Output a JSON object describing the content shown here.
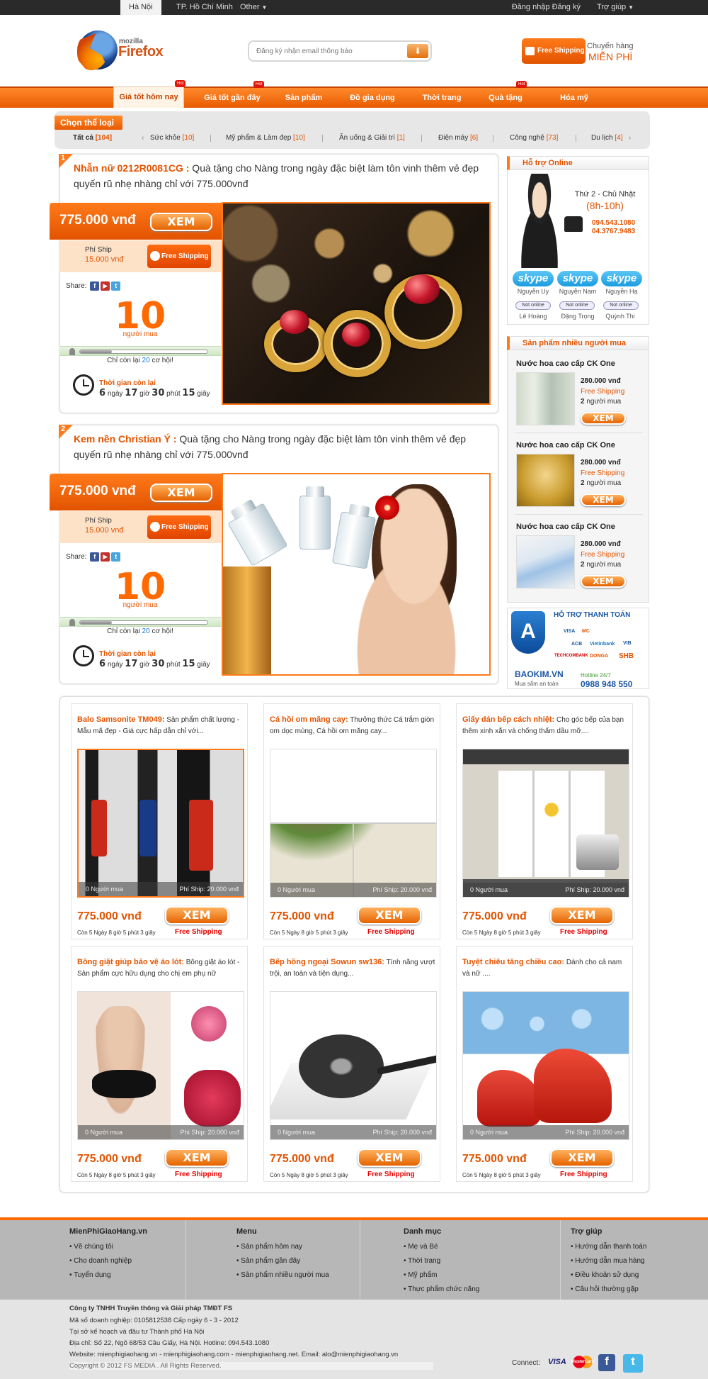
{
  "topbar": {
    "cities": [
      "Hà Nội",
      "TP. Hồ Chí Minh",
      "Other"
    ],
    "login": "Đăng nhập",
    "register": "Đăng ký",
    "help": "Trợ giúp"
  },
  "header": {
    "logo_small": "mozilla",
    "logo_text": "Firefox",
    "subscribe_placeholder": "Đăng ký nhận email thông báo",
    "free_shipping": "Free Shipping",
    "transport_line1": "Chuyển hàng",
    "transport_line2": "MIỄN PHÍ"
  },
  "nav": {
    "items": [
      "Giá tốt hôm nay",
      "Giá tốt gần đây",
      "Sản phẩm",
      "Đồ gia dụng",
      "Thời trang",
      "Quà tặng",
      "Hóa mỹ phẩm"
    ],
    "hot_label": "Hot"
  },
  "categories": {
    "title": "Chọn thể loại",
    "all_label": "Tất cả",
    "all_count": "[104]",
    "items": [
      {
        "label": "Sức khỏe",
        "count": "[10]"
      },
      {
        "label": "Mỹ phẩm & Làm đẹp",
        "count": "[10]"
      },
      {
        "label": "Ăn uống & Giải trí",
        "count": "[1]"
      },
      {
        "label": "Điện máy",
        "count": "[6]"
      },
      {
        "label": "Công nghệ",
        "count": "[73]"
      },
      {
        "label": "Du lịch",
        "count": "[4]"
      }
    ],
    "prev": "‹",
    "next": "›"
  },
  "deals": [
    {
      "num": "1",
      "name": "Nhẫn nữ 0212R0081CG :",
      "desc": " Quà tặng cho Nàng trong ngày đặc biệt làm tôn vinh thêm vẻ đẹp quyến rũ nhẹ nhàng chỉ với 775.000vnđ",
      "price": "775.000 vnđ",
      "xem": "XEM",
      "ship_label": "Phí Ship",
      "ship_price": "15.000 vnđ",
      "free_shipping": "Free Shipping",
      "share": "Share:",
      "buyers": "10",
      "buyers_label": "người mua",
      "remaining_prefix": "Chỉ còn lại ",
      "remaining_n": "20",
      "remaining_suffix": " cơ hội!",
      "progress": 0.25,
      "time_label": "Thời gian còn lại",
      "days": "6",
      "hours": "17",
      "mins": "30",
      "secs": "15",
      "u_day": " ngày ",
      "u_hour": " giờ ",
      "u_min": " phút ",
      "u_sec": " giây"
    },
    {
      "num": "2",
      "name": "Kem nền Christian Ý :",
      "desc": " Quà tặng cho Nàng trong ngày đặc biệt làm tôn vinh thêm vẻ đẹp quyến rũ nhẹ nhàng chỉ với 775.000vnđ",
      "price": "775.000 vnđ",
      "xem": "XEM",
      "ship_label": "Phí Ship",
      "ship_price": "15.000 vnđ",
      "free_shipping": "Free Shipping",
      "share": "Share:",
      "buyers": "10",
      "buyers_label": "người mua",
      "remaining_prefix": "Chỉ còn lại ",
      "remaining_n": "20",
      "remaining_suffix": " cơ hội!",
      "progress": 0.25,
      "time_label": "Thời gian còn lại",
      "days": "6",
      "hours": "17",
      "mins": "30",
      "secs": "15",
      "u_day": " ngày ",
      "u_hour": " giờ ",
      "u_min": " phút ",
      "u_sec": " giây"
    }
  ],
  "support": {
    "title": "Hỗ trợ Online",
    "days": "Thứ 2 - Chủ Nhật",
    "hours": "(8h-10h)",
    "phone1": "094.543.1080",
    "phone2": "04.3767.9483",
    "skype_label": "skype",
    "skype_names": [
      "Nguyễn Uy",
      "Nguyễn Nam",
      "Nguyễn Hạ"
    ],
    "status": "Not online",
    "status_names": [
      "Lê Hoàng",
      "Đặng Trọng",
      "Quỳnh Thi"
    ]
  },
  "bestsellers": {
    "title": "Sản phẩm nhiều người mua",
    "items": [
      {
        "name": "Nước hoa cao cấp CK One",
        "price": "280.000 vnđ",
        "free": "Free Shipping",
        "buyers": "2",
        "buyers_label": " người mua",
        "xem": "XEM"
      },
      {
        "name": "Nước hoa cao cấp CK One",
        "price": "280.000 vnđ",
        "free": "Free Shipping",
        "buyers": "2",
        "buyers_label": " người mua",
        "xem": "XEM"
      },
      {
        "name": "Nước hoa cao cấp CK One",
        "price": "280.000 vnđ",
        "free": "Free Shipping",
        "buyers": "2",
        "buyers_label": " người mua",
        "xem": "XEM"
      }
    ]
  },
  "payment": {
    "title": "HỖ TRỢ THANH TOÁN",
    "banks": [
      "VISA",
      "MC",
      "ACB",
      "Vietinbank",
      "VIB",
      "TECHCOMBANK",
      "DONGA",
      "SHB"
    ],
    "brand": "BAOKIM.VN",
    "brand_sub": "Mua sắm an toàn",
    "hotline_label": "Hotline 24/7",
    "hotline": "0988 948 550"
  },
  "products": [
    {
      "title": "Balo Samsonite TM049:",
      "desc": " Sản phẩm chất lượng - Mẫu mã đẹp - Giá cực hấp dẫn chỉ với...",
      "buyers": "0 Người mua",
      "ship": "Phí Ship: 20.000 vnđ",
      "price": "775.000 vnđ",
      "xem": "XEM",
      "remain": "Còn 5 Ngày 8 giờ 5 phút 3 giây",
      "free": "Free Shipping"
    },
    {
      "title": "Cá hồi om măng cay:",
      "desc": " Thưởng thức Cá trắm giòn om dọc mùng, Cá hồi om măng cay...",
      "buyers": "0 Người mua",
      "ship": "Phí Ship: 20.000 vnđ",
      "price": "775.000 vnđ",
      "xem": "XEM",
      "remain": "Còn 5 Ngày 8 giờ 5 phút 3 giây",
      "free": "Free Shipping"
    },
    {
      "title": "Giấy dán bếp cách nhiệt:",
      "desc": " Cho góc bếp của bạn thêm xinh xắn và chống thấm dầu mỡ....",
      "buyers": "0 Người mua",
      "ship": "Phí Ship: 20.000 vnđ",
      "price": "775.000 vnđ",
      "xem": "XEM",
      "remain": "Còn 5 Ngày 8 giờ 5 phút 3 giây",
      "free": "Free Shipping"
    },
    {
      "title": "Bông giặt giúp bảo vệ áo lót:",
      "desc": " Bông giặt áo lót - Sản phẩm cực hữu dụng cho chị em phụ nữ",
      "buyers": "0 Người mua",
      "ship": "Phí Ship: 20.000 vnđ",
      "price": "775.000 vnđ",
      "xem": "XEM",
      "remain": "Còn 5 Ngày 8 giờ 5 phút 3 giây",
      "free": "Free Shipping"
    },
    {
      "title": "Bếp hồng ngoại Sowun sw136:",
      "desc": " Tính năng vượt trội, an toàn và tiện dụng...",
      "buyers": "0 Người mua",
      "ship": "Phí Ship: 20.000 vnđ",
      "price": "775.000 vnđ",
      "xem": "XEM",
      "remain": "Còn 5 Ngày 8 giờ 5 phút 3 giây",
      "free": "Free Shipping"
    },
    {
      "title": "Tuyệt chiêu tăng chiều cao:",
      "desc": " Dành cho cả nam và nữ ....",
      "buyers": "0 Người mua",
      "ship": "Phí Ship: 20.000 vnđ",
      "price": "775.000 vnđ",
      "xem": "XEM",
      "remain": "Còn 5 Ngày 8 giờ 5 phút 3 giây",
      "free": "Free Shipping"
    }
  ],
  "footer": {
    "cols": [
      {
        "title": "MienPhiGiaoHang.vn",
        "items": [
          "Về chúng tôi",
          "Cho doanh nghiệp",
          "Tuyển dụng"
        ]
      },
      {
        "title": "Menu",
        "items": [
          "Sản phẩm hôm nay",
          "Sản phẩm gần đây",
          "Sản phẩm nhiều người mua"
        ]
      },
      {
        "title": "Danh mục",
        "items": [
          "Mẹ và Bé",
          "Thời trang",
          "Mỹ phẩm",
          "Thực phẩm chức năng"
        ]
      },
      {
        "title": "Trợ giúp",
        "items": [
          "Hướng dẫn thanh toán",
          "Hướng dẫn mua hàng",
          "Điều khoản sử dụng",
          "Câu hỏi thường gặp"
        ]
      }
    ],
    "company": "Công ty TNHH Truyền thông và Giải pháp TMĐT FS",
    "lines": [
      "Mã số doanh nghiệp: 0105812538 Cấp ngày 6 - 3 - 2012",
      "Tại sở kế hoạch và đầu tư Thành phố Hà Nội",
      "Địa chỉ: Số 22, Ngõ 68/53 Cầu Giấy, Hà Nội.   Hotline: 094.543.1080",
      "Website: mienphigiaohang.vn - mienphigiaohang.com - mienphigiaohang.net.   Email: alo@mienphigiaohang.vn",
      "Copyright © 2012 FS MEDIA . All Rights Reserved."
    ],
    "connect": "Connect:",
    "visa": "VISA",
    "mastercard": "MasterCard",
    "fb": "f",
    "tw": "t"
  }
}
